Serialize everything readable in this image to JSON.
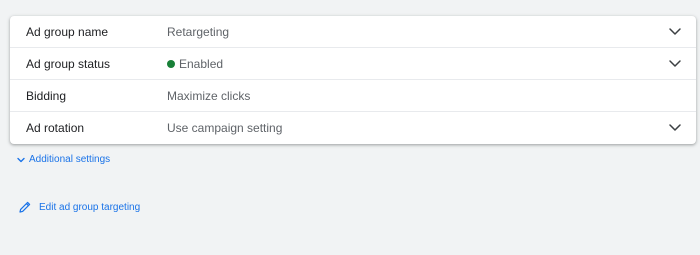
{
  "colors": {
    "page_bg": "#f1f3f4",
    "link": "#1a73e8",
    "status_enabled": "#188038",
    "label": "#202124",
    "value": "#5f6368"
  },
  "settings": {
    "rows": [
      {
        "label": "Ad group name",
        "value": "Retargeting",
        "has_dropdown": true,
        "icon": "chevron-down-icon"
      },
      {
        "label": "Ad group status",
        "value": "Enabled",
        "has_dropdown": true,
        "status_icon": "green-dot-icon",
        "icon": "chevron-down-icon"
      },
      {
        "label": "Bidding",
        "value": "Maximize clicks",
        "has_dropdown": false
      },
      {
        "label": "Ad rotation",
        "value": "Use campaign setting",
        "has_dropdown": true,
        "icon": "chevron-down-icon"
      }
    ]
  },
  "additional_settings": {
    "label": "Additional settings",
    "icon": "chevron-down-icon"
  },
  "edit_targeting": {
    "label": "Edit ad group targeting",
    "icon": "pencil-icon"
  }
}
